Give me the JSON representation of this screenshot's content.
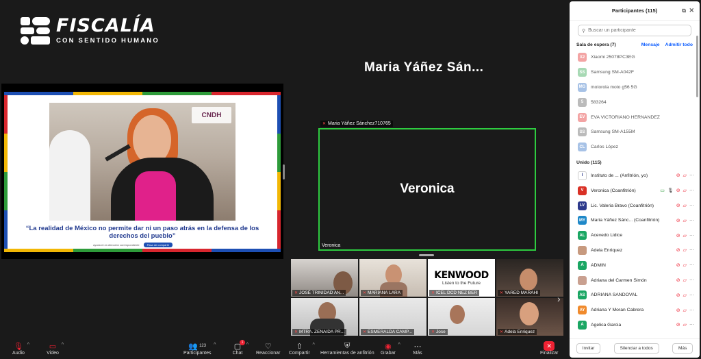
{
  "logo": {
    "title": "FISCALÍA",
    "subtitle": "CON SENTIDO HUMANO"
  },
  "shared_screen": {
    "quote": "“La realidad de México no permite dar ni un paso atrás en la defensa de los derechos del pueblo”",
    "logo_text": "CNDH",
    "footer_text": "ayuda en la dirección correspondiente",
    "footer_button": "Pasa de compartir"
  },
  "speaker": {
    "top_name": "Maria Yáñez Sán...",
    "tag": "Maria Yáñez Sánchez710765",
    "big_name": "Veronica",
    "corner_name": "Veronica"
  },
  "gallery": [
    {
      "label": "JOSÉ TRINIDAD AN..."
    },
    {
      "label": "MARIANA LARA"
    },
    {
      "label": "ICEL DCD NEZ BER",
      "brand": "KENWOOD",
      "tagline": "Listen to the Future"
    },
    {
      "label": "YARED MARAHI"
    },
    {
      "label": "MTRA. ZENAIDA PR..."
    },
    {
      "label": "ESMERALDA CAMP..."
    },
    {
      "label": "Jose"
    },
    {
      "label": "Adela Enriquez"
    }
  ],
  "toolbar": {
    "audio": "Audio",
    "video": "Video",
    "participants": "Participantes",
    "participants_count": "123",
    "chat": "Chat",
    "chat_badge": "1",
    "react": "Reaccionar",
    "share": "Compartir",
    "host_tools": "Herramientas de anfitrión",
    "record": "Grabar",
    "more": "Más",
    "end": "Finalizar"
  },
  "panel": {
    "title": "Participantes (115)",
    "search_placeholder": "Buscar un participante",
    "waiting_title": "Sala de espera (7)",
    "waiting_msg": "Mensaje",
    "waiting_admit": "Admitir todo",
    "waiting": [
      {
        "initials": "X2",
        "name": "Xiaomi 25078PC3EG",
        "color": "#f3a4a4"
      },
      {
        "initials": "SS",
        "name": "Samsung SM-A042F",
        "color": "#a7d9b4"
      },
      {
        "initials": "MG",
        "name": "motorola moto g56 5G",
        "color": "#a7c2e6"
      },
      {
        "initials": "5",
        "name": "583264",
        "color": "#bbbbbb"
      },
      {
        "initials": "EV",
        "name": "EVA VICTORIANO HERNÁNDEZ",
        "color": "#f3a4a4"
      },
      {
        "initials": "SS",
        "name": "Samsung SM-A155M",
        "color": "#bbbbbb"
      },
      {
        "initials": "CL",
        "name": "Carlos López",
        "color": "#a7c2e6"
      }
    ],
    "joined_title": "Unido (115)",
    "joined": [
      {
        "initials": "I",
        "name": "Instituto de ... (Anfitrión, yo)",
        "color": "#ffffff",
        "text": "#2d3a8c"
      },
      {
        "initials": "V",
        "name": "Veronica (Coanfitrión)",
        "color": "#d93025",
        "text": "#ffffff"
      },
      {
        "initials": "LV",
        "name": "Lic. Valeria Bravo (Coanfitrión)",
        "color": "#2d3a8c",
        "text": "#ffffff"
      },
      {
        "initials": "MY",
        "name": "Maria Yáñez Sánc... (Coanfitrión)",
        "color": "#1e88c8",
        "text": "#ffffff"
      },
      {
        "initials": "AL",
        "name": "Acevedo Lidice",
        "color": "#1aa663",
        "text": "#ffffff"
      },
      {
        "initials": "",
        "name": "Adela Enriquez",
        "color": "#c79a7f",
        "text": "#ffffff"
      },
      {
        "initials": "A",
        "name": "ADMIN",
        "color": "#1aa663",
        "text": "#ffffff"
      },
      {
        "initials": "",
        "name": "Adriana del Carmen Simón",
        "color": "#c9a090",
        "text": "#ffffff"
      },
      {
        "initials": "AS",
        "name": "ADRIANA SANDOVAL",
        "color": "#1aa663",
        "text": "#ffffff"
      },
      {
        "initials": "AY",
        "name": "Adriana Y Moran Cabrera",
        "color": "#f08a2c",
        "text": "#ffffff"
      },
      {
        "initials": "A",
        "name": "Agelica Garcia",
        "color": "#1aa663",
        "text": "#ffffff"
      }
    ],
    "footer": {
      "invite": "Invitar",
      "mute_all": "Silenciar a todos",
      "more": "Más"
    }
  }
}
